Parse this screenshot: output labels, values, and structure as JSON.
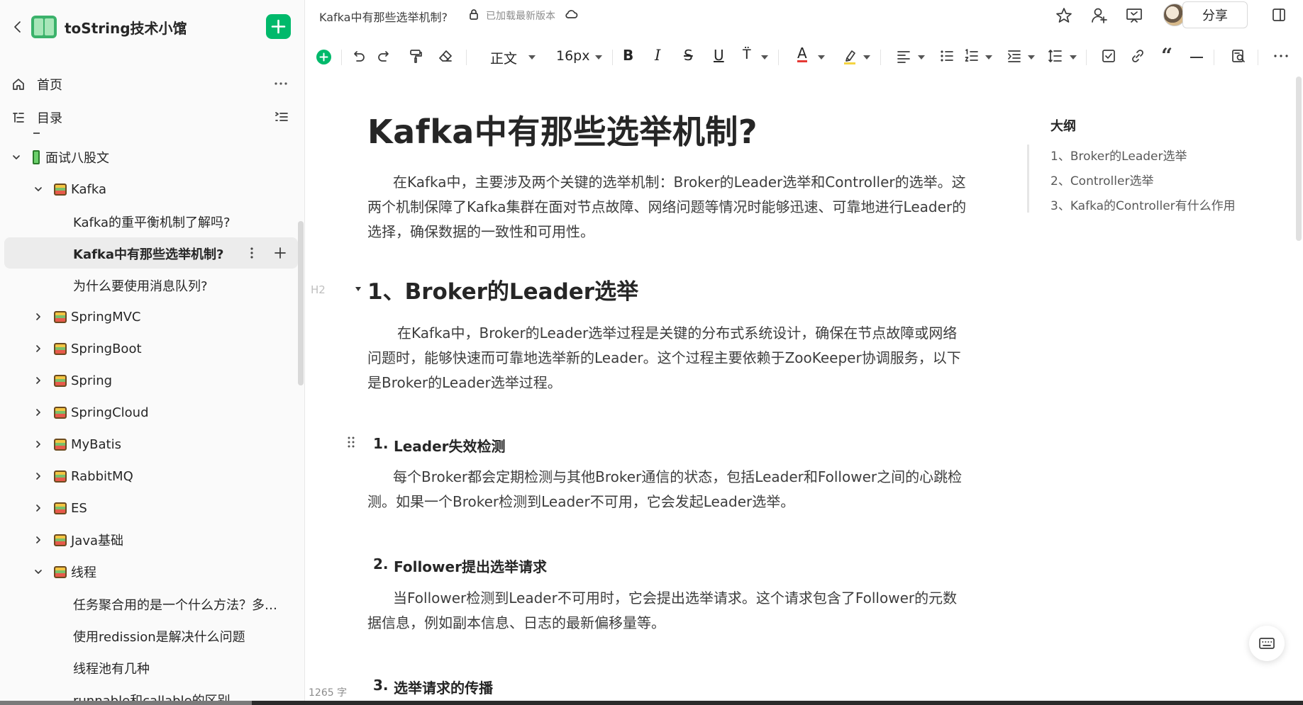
{
  "sidebar": {
    "title": "toString技术小馆",
    "nav": [
      {
        "label": "首页"
      },
      {
        "label": "目录"
      }
    ],
    "tree": [
      {
        "label": "面试八股文"
      },
      {
        "label": "Kafka"
      },
      {
        "label": "Kafka的重平衡机制了解吗?"
      },
      {
        "label": "Kafka中有那些选举机制?"
      },
      {
        "label": "为什么要使用消息队列?"
      },
      {
        "label": "SpringMVC"
      },
      {
        "label": "SpringBoot"
      },
      {
        "label": "Spring"
      },
      {
        "label": "SpringCloud"
      },
      {
        "label": "MyBatis"
      },
      {
        "label": "RabbitMQ"
      },
      {
        "label": "ES"
      },
      {
        "label": "Java基础"
      },
      {
        "label": "线程"
      },
      {
        "label": "任务聚合用的是一个什么方法？多线..."
      },
      {
        "label": "使用redission是解决什么问题"
      },
      {
        "label": "线程池有几种"
      },
      {
        "label": "runnable和callable的区别"
      }
    ]
  },
  "topbar": {
    "doc_title": "Kafka中有那些选举机制?",
    "status": "已加载最新版本",
    "share_label": "分享"
  },
  "toolbar": {
    "style_label": "正文",
    "size_label": "16px"
  },
  "document": {
    "title": "Kafka中有那些选举机制?",
    "intro": "在Kafka中，主要涉及两个关键的选举机制：Broker的Leader选举和Controller的选举。这两个机制保障了Kafka集群在面对节点故障、网络问题等情况时能够迅速、可靠地进行Leader的选择，确保数据的一致性和可用性。",
    "h2_tag": "H2",
    "section1_title": "1、Broker的Leader选举",
    "section1_text": "在Kafka中，Broker的Leader选举过程是关键的分布式系统设计，确保在节点故障或网络问题时，能够快速而可靠地选举新的Leader。这个过程主要依赖于ZooKeeper协调服务，以下是Broker的Leader选举过程。",
    "sub1_num": "1.",
    "sub1_title": "Leader失效检测",
    "sub1_text": "每个Broker都会定期检测与其他Broker通信的状态，包括Leader和Follower之间的心跳检测。如果一个Broker检测到Leader不可用，它会发起Leader选举。",
    "sub2_num": "2.",
    "sub2_title": "Follower提出选举请求",
    "sub2_text": "当Follower检测到Leader不可用时，它会提出选举请求。这个请求包含了Follower的元数据信息，例如副本信息、日志的最新偏移量等。",
    "sub3_num": "3.",
    "sub3_title": "选举请求的传播",
    "word_count": "1265 字"
  },
  "outline": {
    "heading": "大纲",
    "items": [
      {
        "label": "1、Broker的Leader选举"
      },
      {
        "label": "2、Controller选举"
      },
      {
        "label": "3、Kafka的Controller有什么作用"
      }
    ]
  },
  "colors": {
    "accent_green": "#00b96b",
    "text_red": "#e53935"
  }
}
